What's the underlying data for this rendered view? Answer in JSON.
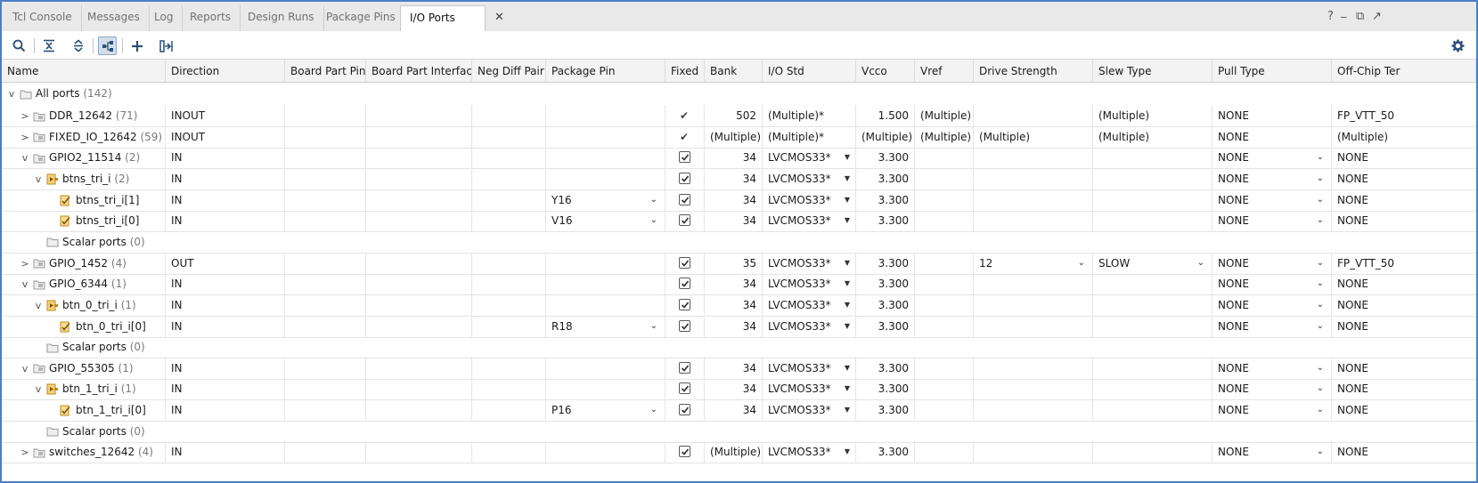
{
  "tabs": [
    "Tcl Console",
    "Messages",
    "Log",
    "Reports",
    "Design Runs",
    "Package Pins",
    "I/O Ports"
  ],
  "active_tab": "I/O Ports",
  "tab_close": "✕",
  "window_controls": [
    "?",
    "_",
    "⧉",
    "↗"
  ],
  "toolbar": [
    "search-icon",
    "collapse-all-icon",
    "expand-all-icon",
    "group-by-interface-icon",
    "add-icon",
    "export-icon",
    "gear-icon"
  ],
  "columns": [
    "Name",
    "Direction",
    "Board Part Pin",
    "Board Part Interface",
    "Neg Diff Pair",
    "Package Pin",
    "Fixed",
    "Bank",
    "I/O Std",
    "Vcco",
    "Vref",
    "Drive Strength",
    "Slew Type",
    "Pull Type",
    "Off-Chip Ter"
  ],
  "root": {
    "label": "All ports",
    "count": "(142)"
  },
  "rows": [
    {
      "name": "DDR_12642",
      "count": "(71)",
      "level": 1,
      "kind": "bus",
      "expander": ">",
      "direction": "INOUT",
      "pkg_pin": "",
      "fixed": "tick",
      "bank": "502",
      "io_std": "(Multiple)*",
      "io_dd": false,
      "vcco": "1.500",
      "vref": "(Multiple)",
      "drive": "",
      "drive_dd": false,
      "slew": "(Multiple)",
      "slew_dd": false,
      "pull": "NONE",
      "pull_dd": false,
      "offchip": "FP_VTT_50"
    },
    {
      "name": "FIXED_IO_12642",
      "count": "(59)",
      "level": 1,
      "kind": "bus",
      "expander": ">",
      "direction": "INOUT",
      "pkg_pin": "",
      "fixed": "tick",
      "bank": "(Multiple)",
      "io_std": "(Multiple)*",
      "io_dd": false,
      "vcco": "(Multiple)",
      "vref": "(Multiple)",
      "drive": "(Multiple)",
      "drive_dd": false,
      "slew": "(Multiple)",
      "slew_dd": false,
      "pull": "NONE",
      "pull_dd": false,
      "offchip": "(Multiple)"
    },
    {
      "name": "GPIO2_11514",
      "count": "(2)",
      "level": 1,
      "kind": "bus",
      "expander": "v",
      "direction": "IN",
      "pkg_pin": "",
      "fixed": "check",
      "bank": "34",
      "io_std": "LVCMOS33*",
      "io_dd": true,
      "vcco": "3.300",
      "vref": "",
      "drive": "",
      "drive_dd": false,
      "slew": "",
      "slew_dd": false,
      "pull": "NONE",
      "pull_dd": true,
      "offchip": "NONE"
    },
    {
      "name": "btns_tri_i",
      "count": "(2)",
      "level": 2,
      "kind": "pbus",
      "expander": "v",
      "direction": "IN",
      "pkg_pin": "",
      "fixed": "check",
      "bank": "34",
      "io_std": "LVCMOS33*",
      "io_dd": true,
      "vcco": "3.300",
      "vref": "",
      "drive": "",
      "drive_dd": false,
      "slew": "",
      "slew_dd": false,
      "pull": "NONE",
      "pull_dd": true,
      "offchip": "NONE"
    },
    {
      "name": "btns_tri_i[1]",
      "count": "",
      "level": 3,
      "kind": "port",
      "expander": "",
      "direction": "IN",
      "pkg_pin": "Y16",
      "fixed": "check",
      "bank": "34",
      "io_std": "LVCMOS33*",
      "io_dd": true,
      "vcco": "3.300",
      "vref": "",
      "drive": "",
      "drive_dd": false,
      "slew": "",
      "slew_dd": false,
      "pull": "NONE",
      "pull_dd": true,
      "offchip": "NONE"
    },
    {
      "name": "btns_tri_i[0]",
      "count": "",
      "level": 3,
      "kind": "port",
      "expander": "",
      "direction": "IN",
      "pkg_pin": "V16",
      "fixed": "check",
      "bank": "34",
      "io_std": "LVCMOS33*",
      "io_dd": true,
      "vcco": "3.300",
      "vref": "",
      "drive": "",
      "drive_dd": false,
      "slew": "",
      "slew_dd": false,
      "pull": "NONE",
      "pull_dd": true,
      "offchip": "NONE"
    },
    {
      "name": "Scalar ports",
      "count": "(0)",
      "level": 2,
      "kind": "folder",
      "expander": "",
      "direction": "",
      "pkg_pin": "",
      "fixed": "",
      "bank": "",
      "io_std": "",
      "io_dd": false,
      "vcco": "",
      "vref": "",
      "drive": "",
      "drive_dd": false,
      "slew": "",
      "slew_dd": false,
      "pull": "",
      "pull_dd": false,
      "offchip": ""
    },
    {
      "name": "GPIO_1452",
      "count": "(4)",
      "level": 1,
      "kind": "bus",
      "expander": ">",
      "direction": "OUT",
      "pkg_pin": "",
      "fixed": "check",
      "bank": "35",
      "io_std": "LVCMOS33*",
      "io_dd": true,
      "vcco": "3.300",
      "vref": "",
      "drive": "12",
      "drive_dd": true,
      "slew": "SLOW",
      "slew_dd": true,
      "pull": "NONE",
      "pull_dd": true,
      "offchip": "FP_VTT_50"
    },
    {
      "name": "GPIO_6344",
      "count": "(1)",
      "level": 1,
      "kind": "bus",
      "expander": "v",
      "direction": "IN",
      "pkg_pin": "",
      "fixed": "check",
      "bank": "34",
      "io_std": "LVCMOS33*",
      "io_dd": true,
      "vcco": "3.300",
      "vref": "",
      "drive": "",
      "drive_dd": false,
      "slew": "",
      "slew_dd": false,
      "pull": "NONE",
      "pull_dd": true,
      "offchip": "NONE"
    },
    {
      "name": "btn_0_tri_i",
      "count": "(1)",
      "level": 2,
      "kind": "pbus",
      "expander": "v",
      "direction": "IN",
      "pkg_pin": "",
      "fixed": "check",
      "bank": "34",
      "io_std": "LVCMOS33*",
      "io_dd": true,
      "vcco": "3.300",
      "vref": "",
      "drive": "",
      "drive_dd": false,
      "slew": "",
      "slew_dd": false,
      "pull": "NONE",
      "pull_dd": true,
      "offchip": "NONE"
    },
    {
      "name": "btn_0_tri_i[0]",
      "count": "",
      "level": 3,
      "kind": "port",
      "expander": "",
      "direction": "IN",
      "pkg_pin": "R18",
      "fixed": "check",
      "bank": "34",
      "io_std": "LVCMOS33*",
      "io_dd": true,
      "vcco": "3.300",
      "vref": "",
      "drive": "",
      "drive_dd": false,
      "slew": "",
      "slew_dd": false,
      "pull": "NONE",
      "pull_dd": true,
      "offchip": "NONE"
    },
    {
      "name": "Scalar ports",
      "count": "(0)",
      "level": 2,
      "kind": "folder",
      "expander": "",
      "direction": "",
      "pkg_pin": "",
      "fixed": "",
      "bank": "",
      "io_std": "",
      "io_dd": false,
      "vcco": "",
      "vref": "",
      "drive": "",
      "drive_dd": false,
      "slew": "",
      "slew_dd": false,
      "pull": "",
      "pull_dd": false,
      "offchip": ""
    },
    {
      "name": "GPIO_55305",
      "count": "(1)",
      "level": 1,
      "kind": "bus",
      "expander": "v",
      "direction": "IN",
      "pkg_pin": "",
      "fixed": "check",
      "bank": "34",
      "io_std": "LVCMOS33*",
      "io_dd": true,
      "vcco": "3.300",
      "vref": "",
      "drive": "",
      "drive_dd": false,
      "slew": "",
      "slew_dd": false,
      "pull": "NONE",
      "pull_dd": true,
      "offchip": "NONE"
    },
    {
      "name": "btn_1_tri_i",
      "count": "(1)",
      "level": 2,
      "kind": "pbus",
      "expander": "v",
      "direction": "IN",
      "pkg_pin": "",
      "fixed": "check",
      "bank": "34",
      "io_std": "LVCMOS33*",
      "io_dd": true,
      "vcco": "3.300",
      "vref": "",
      "drive": "",
      "drive_dd": false,
      "slew": "",
      "slew_dd": false,
      "pull": "NONE",
      "pull_dd": true,
      "offchip": "NONE"
    },
    {
      "name": "btn_1_tri_i[0]",
      "count": "",
      "level": 3,
      "kind": "port",
      "expander": "",
      "direction": "IN",
      "pkg_pin": "P16",
      "fixed": "check",
      "bank": "34",
      "io_std": "LVCMOS33*",
      "io_dd": true,
      "vcco": "3.300",
      "vref": "",
      "drive": "",
      "drive_dd": false,
      "slew": "",
      "slew_dd": false,
      "pull": "NONE",
      "pull_dd": true,
      "offchip": "NONE"
    },
    {
      "name": "Scalar ports",
      "count": "(0)",
      "level": 2,
      "kind": "folder",
      "expander": "",
      "direction": "",
      "pkg_pin": "",
      "fixed": "",
      "bank": "",
      "io_std": "",
      "io_dd": false,
      "vcco": "",
      "vref": "",
      "drive": "",
      "drive_dd": false,
      "slew": "",
      "slew_dd": false,
      "pull": "",
      "pull_dd": false,
      "offchip": ""
    },
    {
      "name": "switches_12642",
      "count": "(4)",
      "level": 1,
      "kind": "bus",
      "expander": ">",
      "direction": "IN",
      "pkg_pin": "",
      "fixed": "check",
      "bank": "(Multiple)",
      "io_std": "LVCMOS33*",
      "io_dd": true,
      "vcco": "3.300",
      "vref": "",
      "drive": "",
      "drive_dd": false,
      "slew": "",
      "slew_dd": false,
      "pull": "NONE",
      "pull_dd": true,
      "offchip": "NONE"
    }
  ],
  "colors": {
    "accent": "#4a7fc4",
    "port_icon": "#d6a21e",
    "folder_icon": "#9a9a9a"
  }
}
